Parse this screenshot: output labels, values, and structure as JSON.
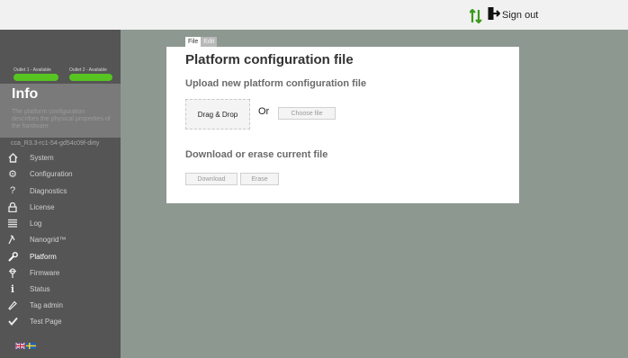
{
  "topbar": {
    "signout_label": "Sign out"
  },
  "sidebar": {
    "outlets": [
      {
        "label": "Outlet 1 - Available",
        "status_color": "#58c421"
      },
      {
        "label": "Outlet 2 - Available",
        "status_color": "#58c421"
      }
    ],
    "header_title": "Info",
    "header_desc": "The platform configuration describes the physical properties of the hardware",
    "version": "cca_R3.3-rc1-54-gd54c09f-dirty",
    "items": [
      {
        "label": "System",
        "icon": "home-icon"
      },
      {
        "label": "Configuration",
        "icon": "gear-icon"
      },
      {
        "label": "Diagnostics",
        "icon": "question-icon"
      },
      {
        "label": "License",
        "icon": "lock-icon"
      },
      {
        "label": "Log",
        "icon": "list-icon"
      },
      {
        "label": "Nanogrid™",
        "icon": "nanogrid-icon"
      },
      {
        "label": "Platform",
        "icon": "wrench-icon",
        "active": true
      },
      {
        "label": "Firmware",
        "icon": "firmware-icon"
      },
      {
        "label": "Status",
        "icon": "info-icon"
      },
      {
        "label": "Tag admin",
        "icon": "tag-icon"
      },
      {
        "label": "Test Page",
        "icon": "check-icon"
      }
    ]
  },
  "tabs": {
    "file": "File",
    "edit": "Edit"
  },
  "main": {
    "title": "Platform configuration file",
    "upload_title": "Upload new platform configuration file",
    "dropzone_label": "Drag & Drop",
    "or_label": "Or",
    "choose_file_label": "Choose file",
    "download_title": "Download or erase current file",
    "download_label": "Download",
    "erase_label": "Erase"
  },
  "colors": {
    "accent_green": "#58c421",
    "sidebar_bg": "#555555",
    "page_bg": "#8d9891"
  }
}
